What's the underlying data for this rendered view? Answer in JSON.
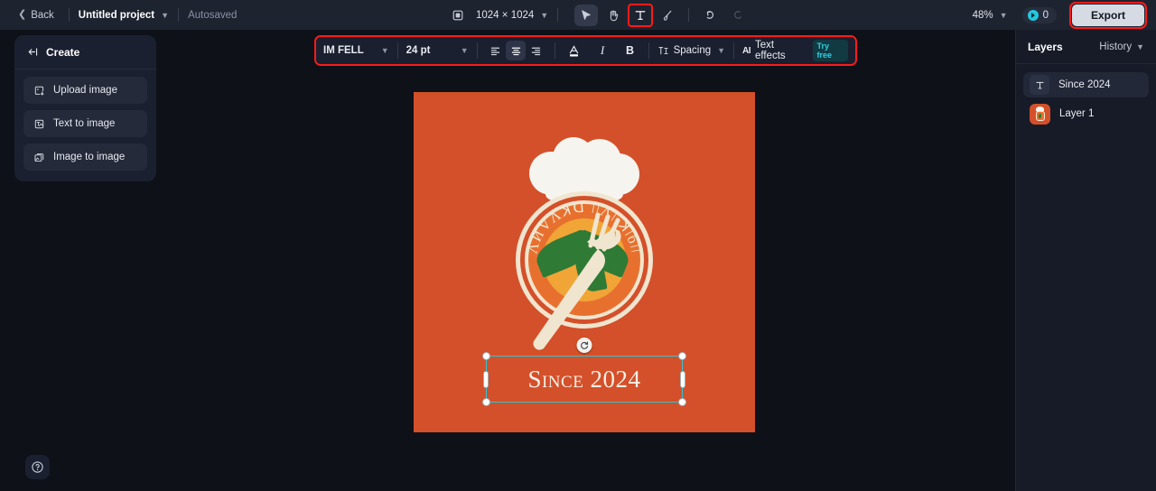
{
  "topbar": {
    "back_label": "Back",
    "project_name": "Untitled project",
    "autosaved_label": "Autosaved",
    "canvas_size": "1024 × 1024",
    "zoom_level": "48%",
    "credits_count": "0",
    "export_label": "Export",
    "tools": [
      {
        "name": "resize-icon",
        "label": "resize"
      },
      {
        "name": "select-tool",
        "label": "select"
      },
      {
        "name": "hand-tool",
        "label": "hand"
      },
      {
        "name": "text-tool",
        "label": "text"
      },
      {
        "name": "brush-tool",
        "label": "brush"
      },
      {
        "name": "undo-button",
        "label": "undo"
      },
      {
        "name": "redo-button",
        "label": "redo"
      }
    ]
  },
  "left_panel": {
    "title": "Create",
    "items": [
      {
        "label": "Upload image",
        "icon": "upload-image-icon"
      },
      {
        "label": "Text to image",
        "icon": "text-to-image-icon"
      },
      {
        "label": "Image to image",
        "icon": "image-to-image-icon"
      }
    ]
  },
  "text_toolbar": {
    "font_family": "IM FELL",
    "font_size": "24 pt",
    "align_left": "align-left",
    "align_center": "align-center",
    "align_right": "align-right",
    "text_color": "A",
    "italic": "I",
    "bold": "B",
    "spacing_label": "Spacing",
    "ai_mark": "AI",
    "text_effects_label": "Text effects",
    "try_free_label": "Try free"
  },
  "canvas": {
    "background_color": "#d4502a",
    "selected_text": "Since 2024",
    "logo": {
      "hat_color": "#f6f4ef",
      "ring_cream": "#f0e5cf",
      "ring_orange": "#e8702f",
      "inner_color": "#f0a536",
      "leaf_color": "#2f7a35",
      "fork_color": "#f0e5cf"
    },
    "selection_color": "#2cc5d8"
  },
  "right_panel": {
    "title": "Layers",
    "history_label": "History",
    "layers": [
      {
        "name": "Since 2024",
        "type": "text",
        "selected": true
      },
      {
        "name": "Layer 1",
        "type": "image",
        "selected": false
      }
    ]
  },
  "help": {
    "label": "?"
  }
}
